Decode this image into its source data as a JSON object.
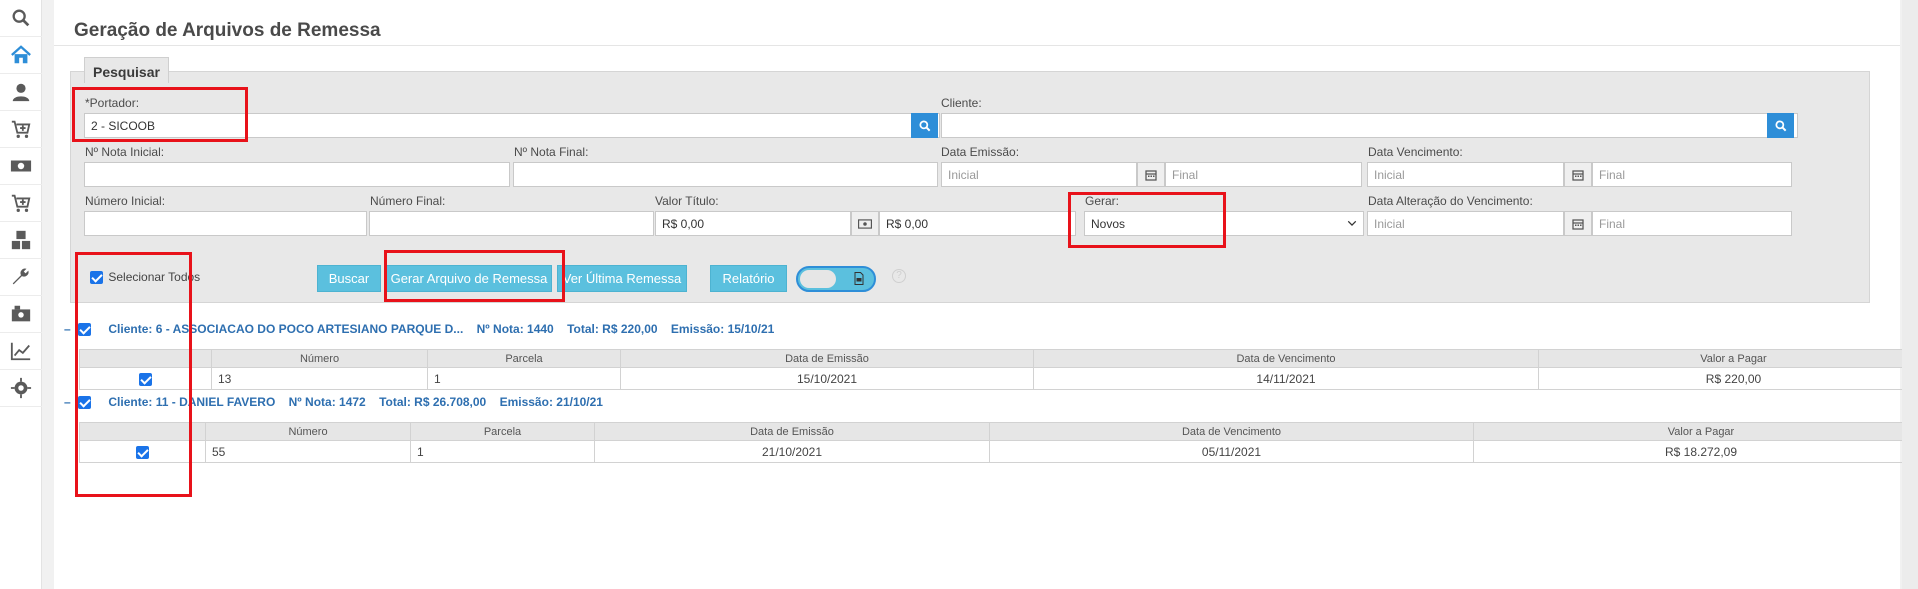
{
  "sidebar": {
    "items": [
      {
        "icon": "search-icon"
      },
      {
        "icon": "home-icon"
      },
      {
        "icon": "user-icon"
      },
      {
        "icon": "cart-add-icon"
      },
      {
        "icon": "money-icon"
      },
      {
        "icon": "cart-icon"
      },
      {
        "icon": "boxes-icon"
      },
      {
        "icon": "wrench-icon"
      },
      {
        "icon": "cash-register-icon"
      },
      {
        "icon": "chart-line-icon"
      },
      {
        "icon": "gear-icon"
      }
    ]
  },
  "page": {
    "title": "Geração de Arquivos de Remessa",
    "tab": "Pesquisar"
  },
  "form": {
    "portador": {
      "label": "*Portador:",
      "value": "2 - SICOOB"
    },
    "cliente": {
      "label": "Cliente:",
      "value": ""
    },
    "nota_inicial": {
      "label": "Nº Nota Inicial:",
      "value": ""
    },
    "nota_final": {
      "label": "Nº Nota Final:",
      "value": ""
    },
    "data_emissao": {
      "label": "Data Emissão:",
      "start_ph": "Inicial",
      "end_ph": "Final"
    },
    "data_vencimento": {
      "label": "Data Vencimento:",
      "start_ph": "Inicial",
      "end_ph": "Final"
    },
    "numero_inicial": {
      "label": "Número Inicial:",
      "value": ""
    },
    "numero_final": {
      "label": "Número Final:",
      "value": ""
    },
    "valor_titulo": {
      "label": "Valor Título:",
      "start": "R$ 0,00",
      "end": "R$ 0,00"
    },
    "gerar": {
      "label": "Gerar:",
      "value": "Novos"
    },
    "data_alteracao": {
      "label": "Data Alteração do Vencimento:",
      "start_ph": "Inicial",
      "end_ph": "Final"
    }
  },
  "actions": {
    "select_all": "Selecionar Todos",
    "buscar": "Buscar",
    "gerar_arquivo": "Gerar Arquivo de Remessa",
    "ver_ultima": "Ver Última Remessa",
    "relatorio": "Relatório",
    "help": "?"
  },
  "groups": [
    {
      "cliente": "Cliente: 6 - ASSOCIACAO DO POCO ARTESIANO PARQUE D...",
      "nota": "Nº Nota: 1440",
      "total": "Total: R$ 220,00",
      "emissao": "Emissão: 15/10/21",
      "columns": [
        "Número",
        "Parcela",
        "Data de Emissão",
        "Data de Vencimento",
        "Valor a Pagar"
      ],
      "rows": [
        {
          "numero": "13",
          "parcela": "1",
          "emissao": "15/10/2021",
          "vencimento": "14/11/2021",
          "valor": "R$ 220,00"
        }
      ]
    },
    {
      "cliente": "Cliente: 11 - DANIEL FAVERO",
      "nota": "Nº Nota: 1472",
      "total": "Total: R$ 26.708,00",
      "emissao": "Emissão: 21/10/21",
      "columns": [
        "Número",
        "Parcela",
        "Data de Emissão",
        "Data de Vencimento",
        "Valor a Pagar"
      ],
      "rows": [
        {
          "numero": "55",
          "parcela": "1",
          "emissao": "21/10/2021",
          "vencimento": "05/11/2021",
          "valor": "R$ 18.272,09"
        }
      ]
    }
  ],
  "colors": {
    "primary": "#2e8ed8",
    "info_button": "#5bc0de",
    "annotation_red": "#e8121a",
    "link_blue": "#2e6fb0"
  }
}
